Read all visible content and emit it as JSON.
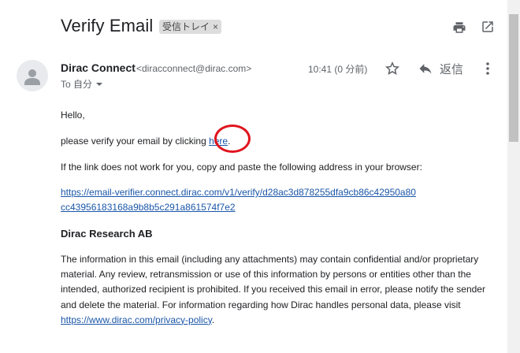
{
  "header": {
    "subject": "Verify Email",
    "label_chip": "受信トレイ",
    "label_close": "×",
    "print_icon": "print-icon",
    "popout_icon": "open-in-new-icon"
  },
  "message": {
    "sender_name": "Dirac Connect",
    "sender_email": "<diracconnect@dirac.com>",
    "to_line": "To 自分",
    "time": "10:41 (0 分前)",
    "reply_label": "返信",
    "star_icon": "star-icon",
    "reply_icon": "reply-icon",
    "more_icon": "more-vert-icon",
    "avatar_icon": "person-avatar-icon"
  },
  "body": {
    "greeting": "Hello,",
    "verify_text": "please verify your email by clicking ",
    "verify_link": "here",
    "verify_end": ".",
    "fallback_text": "If the link does not work for you, copy and paste the following address in your browser:",
    "url_line1": "https://email-verifier.connect.dirac.com/v1/verify/d28ac3d878255dfa9cb86c42950a80",
    "url_line2": "cc43956183168a9b8b5c291a861574f7e2",
    "company": "Dirac Research AB",
    "disclaimer": "The information in this email (including any attachments) may contain confidential and/or proprietary material. Any review, retransmission or use of this information by persons or entities other than the intended, authorized recipient is prohibited. If you received this email in error, please notify the sender and delete the material. For information regarding how Dirac handles personal data, please visit ",
    "privacy_link": "https://www.dirac.com/privacy-policy",
    "disclaimer_end": "."
  },
  "colors": {
    "link": "#1a56a8",
    "annotation_circle": "#e0141e"
  }
}
